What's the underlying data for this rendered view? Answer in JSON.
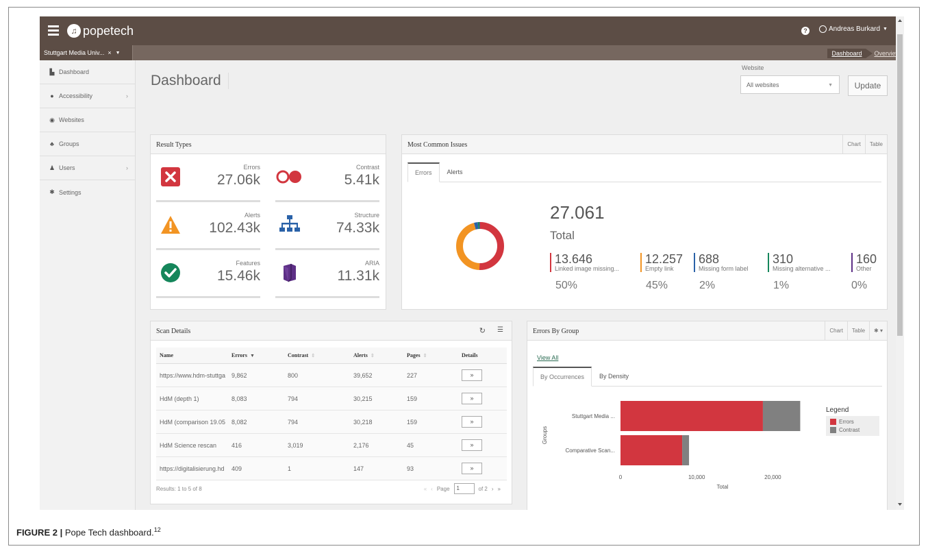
{
  "topbar": {
    "brand": "popetech",
    "user": "Andreas Burkard"
  },
  "subbar": {
    "site": "Stuttgart Media Univ...",
    "site_close": "×",
    "breadcrumb": [
      "Dashboard",
      "Overview"
    ]
  },
  "sidebar": {
    "items": [
      {
        "label": "Dashboard",
        "icon": "chart-icon"
      },
      {
        "label": "Accessibility",
        "icon": "accessibility-icon",
        "has_children": true
      },
      {
        "label": "Websites",
        "icon": "globe-icon"
      },
      {
        "label": "Groups",
        "icon": "sitemap-icon"
      },
      {
        "label": "Users",
        "icon": "user-icon",
        "has_children": true
      },
      {
        "label": "Settings",
        "icon": "gear-icon"
      }
    ]
  },
  "page": {
    "title": "Dashboard",
    "website_label": "Website",
    "website_value": "All websites",
    "update_label": "Update"
  },
  "result_types": {
    "title": "Result Types",
    "items": [
      {
        "label": "Errors",
        "value": "27.06k",
        "icon": "error-x-icon",
        "color": "#d2363f"
      },
      {
        "label": "Contrast",
        "value": "5.41k",
        "icon": "contrast-circles-icon",
        "color": "#d2363f"
      },
      {
        "label": "Alerts",
        "value": "102.43k",
        "icon": "warning-triangle-icon",
        "color": "#f29423"
      },
      {
        "label": "Structure",
        "value": "74.33k",
        "icon": "structure-tree-icon",
        "color": "#2a62a8"
      },
      {
        "label": "Features",
        "value": "15.46k",
        "icon": "checkmark-circle-icon",
        "color": "#15865b"
      },
      {
        "label": "ARIA",
        "value": "11.31k",
        "icon": "aria-cube-icon",
        "color": "#5d2f86"
      }
    ]
  },
  "common_issues": {
    "title": "Most Common Issues",
    "tools": [
      "Chart",
      "Table"
    ],
    "tabs": [
      "Errors",
      "Alerts"
    ],
    "total": "27.061",
    "total_label": "Total",
    "stats": [
      {
        "count": "13.646",
        "label": "Linked image missing...",
        "percent": "50%",
        "color": "#d2363f"
      },
      {
        "count": "12.257",
        "label": "Empty link",
        "percent": "45%",
        "color": "#f29423"
      },
      {
        "count": "688",
        "label": "Missing form label",
        "percent": "2%",
        "color": "#2a62a8"
      },
      {
        "count": "310",
        "label": "Missing alternative ...",
        "percent": "1%",
        "color": "#15865b"
      },
      {
        "count": "160",
        "label": "Other",
        "percent": "0%",
        "color": "#5d2f86"
      }
    ]
  },
  "scan_details": {
    "title": "Scan Details",
    "columns": [
      "Name",
      "Errors",
      "Contrast",
      "Alerts",
      "Pages",
      "Details"
    ],
    "rows": [
      {
        "name": "https://www.hdm-stuttga",
        "errors": "9,862",
        "contrast": "800",
        "alerts": "39,652",
        "pages": "227"
      },
      {
        "name": "HdM (depth 1)",
        "errors": "8,083",
        "contrast": "794",
        "alerts": "30,215",
        "pages": "159"
      },
      {
        "name": "HdM (comparison 19.05",
        "errors": "8,082",
        "contrast": "794",
        "alerts": "30,218",
        "pages": "159"
      },
      {
        "name": "HdM Science rescan",
        "errors": "416",
        "contrast": "3,019",
        "alerts": "2,176",
        "pages": "45"
      },
      {
        "name": "https://digitalisierung.hd",
        "errors": "409",
        "contrast": "1",
        "alerts": "147",
        "pages": "93"
      }
    ],
    "details_label": "»",
    "results_text": "Results: 1 to 5 of 8",
    "pager": {
      "page_label": "Page",
      "page_value": "1",
      "of_label": "of 2"
    }
  },
  "errors_by_group": {
    "title": "Errors By Group",
    "tools": [
      "Chart",
      "Table"
    ],
    "view_all": "View All",
    "tabs": [
      "By Occurrences",
      "By Density"
    ]
  },
  "chart_data": {
    "type": "bar",
    "orientation": "horizontal",
    "stacked": true,
    "categories": [
      "Stuttgart Media ...",
      "Comparative Scan..."
    ],
    "series": [
      {
        "name": "Errors",
        "values": [
          18700,
          8100
        ],
        "color": "#d2363f"
      },
      {
        "name": "Contrast",
        "values": [
          4900,
          900
        ],
        "color": "#808080"
      }
    ],
    "xlabel": "Total",
    "ylabel": "Groups",
    "xticks": [
      "0",
      "10,000",
      "20,000"
    ],
    "xtick_values": [
      0,
      10000,
      20000
    ],
    "xlim": [
      0,
      25000
    ],
    "legend_title": "Legend",
    "legend_position": "right"
  },
  "caption": {
    "prefix": "FIGURE 2 |",
    "text": "Pope Tech dashboard.",
    "superscript": "12"
  },
  "donut": {
    "values": [
      13646,
      12257,
      688,
      310,
      160
    ],
    "colors": [
      "#d2363f",
      "#f29423",
      "#2a62a8",
      "#15865b",
      "#5d2f86"
    ]
  }
}
